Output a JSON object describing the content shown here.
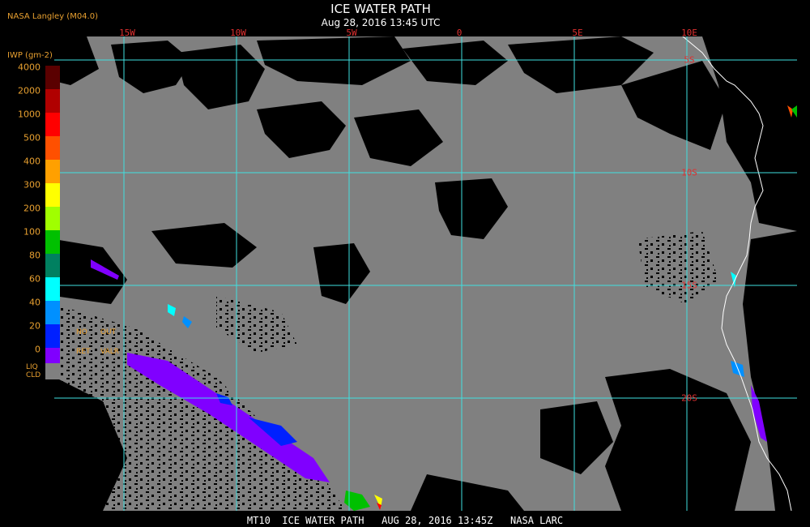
{
  "header": {
    "source": "NASA Langley (M04.0)",
    "title": "ICE WATER PATH",
    "subtitle": "Aug 28, 2016 13:45 UTC"
  },
  "longitude_labels": [
    "15W",
    "10W",
    "5W",
    "0",
    "5E",
    "10E"
  ],
  "latitude_labels": [
    "5S",
    "10S",
    "15S",
    "20S"
  ],
  "legend": {
    "title": "IWP (gm-2)",
    "levels": [
      "4000",
      "2000",
      "1000",
      "500",
      "400",
      "300",
      "200",
      "100",
      "80",
      "60",
      "40",
      "20",
      "0"
    ],
    "colors": [
      "#5a0000",
      "#b00000",
      "#ff0000",
      "#ff5000",
      "#ffa000",
      "#ffff00",
      "#a0ff00",
      "#00c000",
      "#008060",
      "#00ffff",
      "#0090ff",
      "#0020ff",
      "#8000ff"
    ],
    "annotations": {
      "no": "NO",
      "out": "OUT",
      "ret": "RET",
      "valr": "VALR",
      "liq": "LIQ",
      "cld": "CLD"
    },
    "liq_color": "#808080"
  },
  "footer": "MT10  ICE WATER PATH   AUG 28, 2016 13:45Z   NASA LARC",
  "colors": {
    "grid": "#40e0e0",
    "coast": "#ffffff",
    "cloud_gray": "#808080",
    "clear_black": "#000000"
  }
}
